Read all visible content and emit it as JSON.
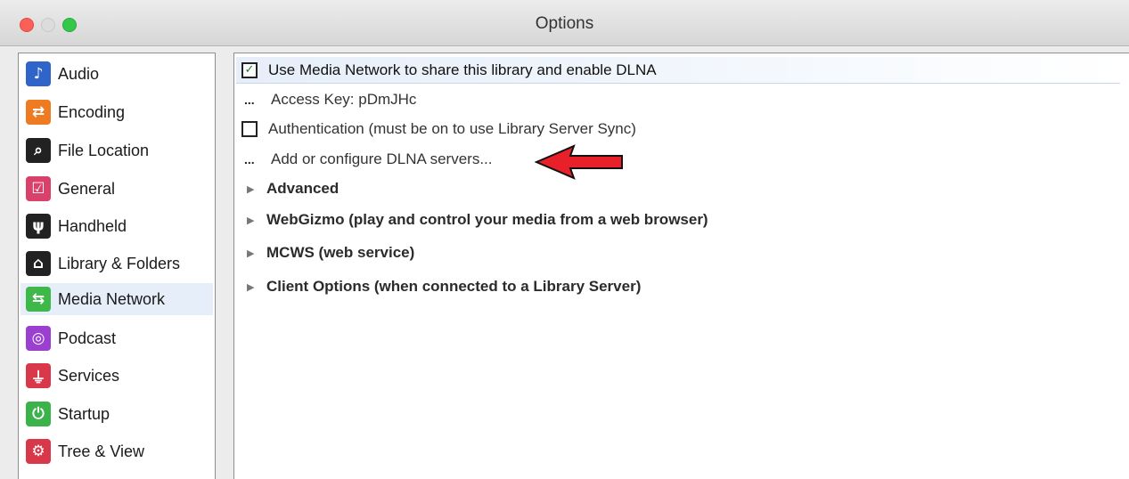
{
  "window": {
    "title": "Options"
  },
  "sidebar": {
    "items": [
      {
        "label": "Audio",
        "icon": "music-note-icon",
        "glyph": "♪",
        "color": "#2f64c8"
      },
      {
        "label": "Encoding",
        "icon": "encoding-icon",
        "glyph": "⇄",
        "color": "#ee7a22"
      },
      {
        "label": "File Location",
        "icon": "file-location-icon",
        "glyph": "⌕",
        "color": "#222222"
      },
      {
        "label": "General",
        "icon": "general-checkbox-icon",
        "glyph": "☑",
        "color": "#d9416b"
      },
      {
        "label": "Handheld",
        "icon": "usb-icon",
        "glyph": "ψ",
        "color": "#222222"
      },
      {
        "label": "Library & Folders",
        "icon": "home-icon",
        "glyph": "⌂",
        "color": "#222222"
      },
      {
        "label": "Media Network",
        "icon": "media-network-icon",
        "glyph": "⇆",
        "color": "#3fb84a",
        "selected": true
      },
      {
        "label": "Podcast",
        "icon": "podcast-icon",
        "glyph": "◎",
        "color": "#9b3fd0"
      },
      {
        "label": "Services",
        "icon": "plug-icon",
        "glyph": "⏚",
        "color": "#d8384a"
      },
      {
        "label": "Startup",
        "icon": "power-icon",
        "glyph": "⏻",
        "color": "#3bb34a"
      },
      {
        "label": "Tree & View",
        "icon": "gear-icon",
        "glyph": "⚙",
        "color": "#d8384a"
      }
    ]
  },
  "main": {
    "share_checkbox": {
      "label": "Use Media Network to share this library and enable DLNA",
      "checked": true
    },
    "access_key": {
      "label": "Access Key: pDmJHc"
    },
    "authentication": {
      "label": "Authentication (must be on to use Library Server Sync)",
      "checked": false
    },
    "dlna_servers": {
      "label": "Add or configure DLNA servers..."
    },
    "sections": [
      {
        "label": "Advanced"
      },
      {
        "label": "WebGizmo (play and control your media from a web browser)"
      },
      {
        "label": "MCWS (web service)"
      },
      {
        "label": "Client Options (when connected to a Library Server)"
      }
    ],
    "ellipsis_glyph": "...",
    "disclosure_glyph": "▶",
    "check_glyph": "✓"
  },
  "annotation": {
    "arrow_color": "#e8202a"
  }
}
